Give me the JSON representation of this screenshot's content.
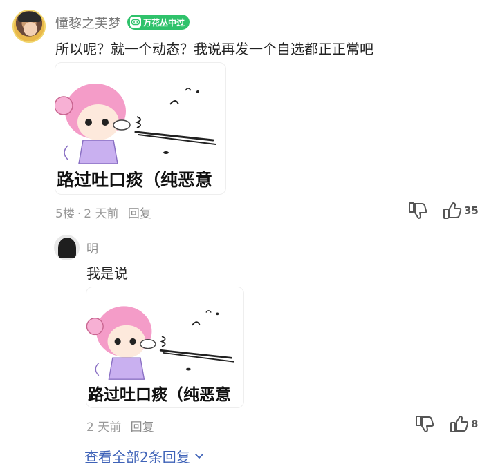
{
  "comment": {
    "username": "憧黎之芙梦",
    "badge": "万花丛中过",
    "text": "所以呢？就一个动态？我说再发一个自选都正正常吧",
    "sticker_caption": "路过吐口痰（纯恶意",
    "floor": "5楼",
    "separator": "·",
    "time": "2 天前",
    "reply_label": "回复",
    "like_count": "35"
  },
  "reply": {
    "username": "明",
    "text": "我是说",
    "sticker_caption": "路过吐口痰（纯恶意",
    "time": "2 天前",
    "reply_label": "回复",
    "like_count": "8"
  },
  "view_all": "查看全部2条回复",
  "colors": {
    "badge": "#2fc26b",
    "link": "#3f63b8",
    "meta": "#9a9a9a"
  },
  "icons": [
    "gamepad-icon",
    "dislike-icon",
    "like-icon",
    "chevron-down-icon"
  ]
}
